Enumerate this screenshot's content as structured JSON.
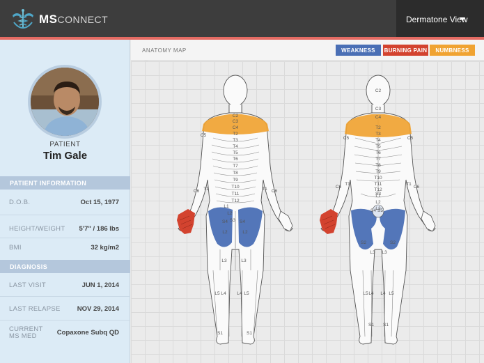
{
  "brand": {
    "ms": "MS",
    "connect": "CONNECT"
  },
  "view_select": {
    "label": "Dermatone View"
  },
  "patient": {
    "label": "PATIENT",
    "name": "Tim Gale"
  },
  "sections": {
    "info_title": "PATIENT INFORMATION",
    "info_rows": [
      {
        "key": "D.O.B.",
        "value": "Oct 15, 1977"
      },
      {
        "key": "HEIGHT/WEIGHT",
        "value": "5'7\" / 186 lbs"
      },
      {
        "key": "BMI",
        "value": "32 kg/m2"
      }
    ],
    "diag_title": "DIAGNOSIS",
    "diag_rows": [
      {
        "key": "LAST VISIT",
        "value": "JUN 1, 2014"
      },
      {
        "key": "LAST RELAPSE",
        "value": "NOV 29, 2014"
      },
      {
        "key": "CURRENT MS MED",
        "value": "Copaxone Subq QD"
      }
    ]
  },
  "main": {
    "tab_label": "ANATOMY MAP",
    "legend": [
      {
        "label": "WEAKNESS",
        "color": "#4a6fb5"
      },
      {
        "label": "BURNING PAIN",
        "color": "#d3432f"
      },
      {
        "label": "NUMBNESS",
        "color": "#f0a332"
      }
    ]
  },
  "colors": {
    "weakness": "#4a6fb5",
    "burning_pain": "#d3432f",
    "numbness": "#f0a332",
    "accent": "#e46b63"
  },
  "anatomy_labels": {
    "front": [
      "C2",
      "C3",
      "C4",
      "T2",
      "T3",
      "T4",
      "T5",
      "T6",
      "T7",
      "T8",
      "T9",
      "T10",
      "T11",
      "T12",
      "C5",
      "T1",
      "C6",
      "C6",
      "T1",
      "L1",
      "L2",
      "S3",
      "S4",
      "S4",
      "L2",
      "L2",
      "L3",
      "L3",
      "L4",
      "L5",
      "L4",
      "L5",
      "S1",
      "S1"
    ],
    "back": [
      "C2",
      "C3",
      "C4",
      "T2",
      "T3",
      "T4",
      "T5",
      "T6",
      "T7",
      "T8",
      "T9",
      "T10",
      "T11",
      "T12",
      "L1",
      "L2",
      "L3",
      "C5",
      "C5",
      "T1",
      "C6",
      "C6",
      "T1",
      "S3",
      "S4",
      "S5",
      "S2",
      "S2",
      "L3",
      "L3",
      "L4",
      "L5",
      "L4",
      "L5",
      "S1",
      "S1"
    ]
  }
}
